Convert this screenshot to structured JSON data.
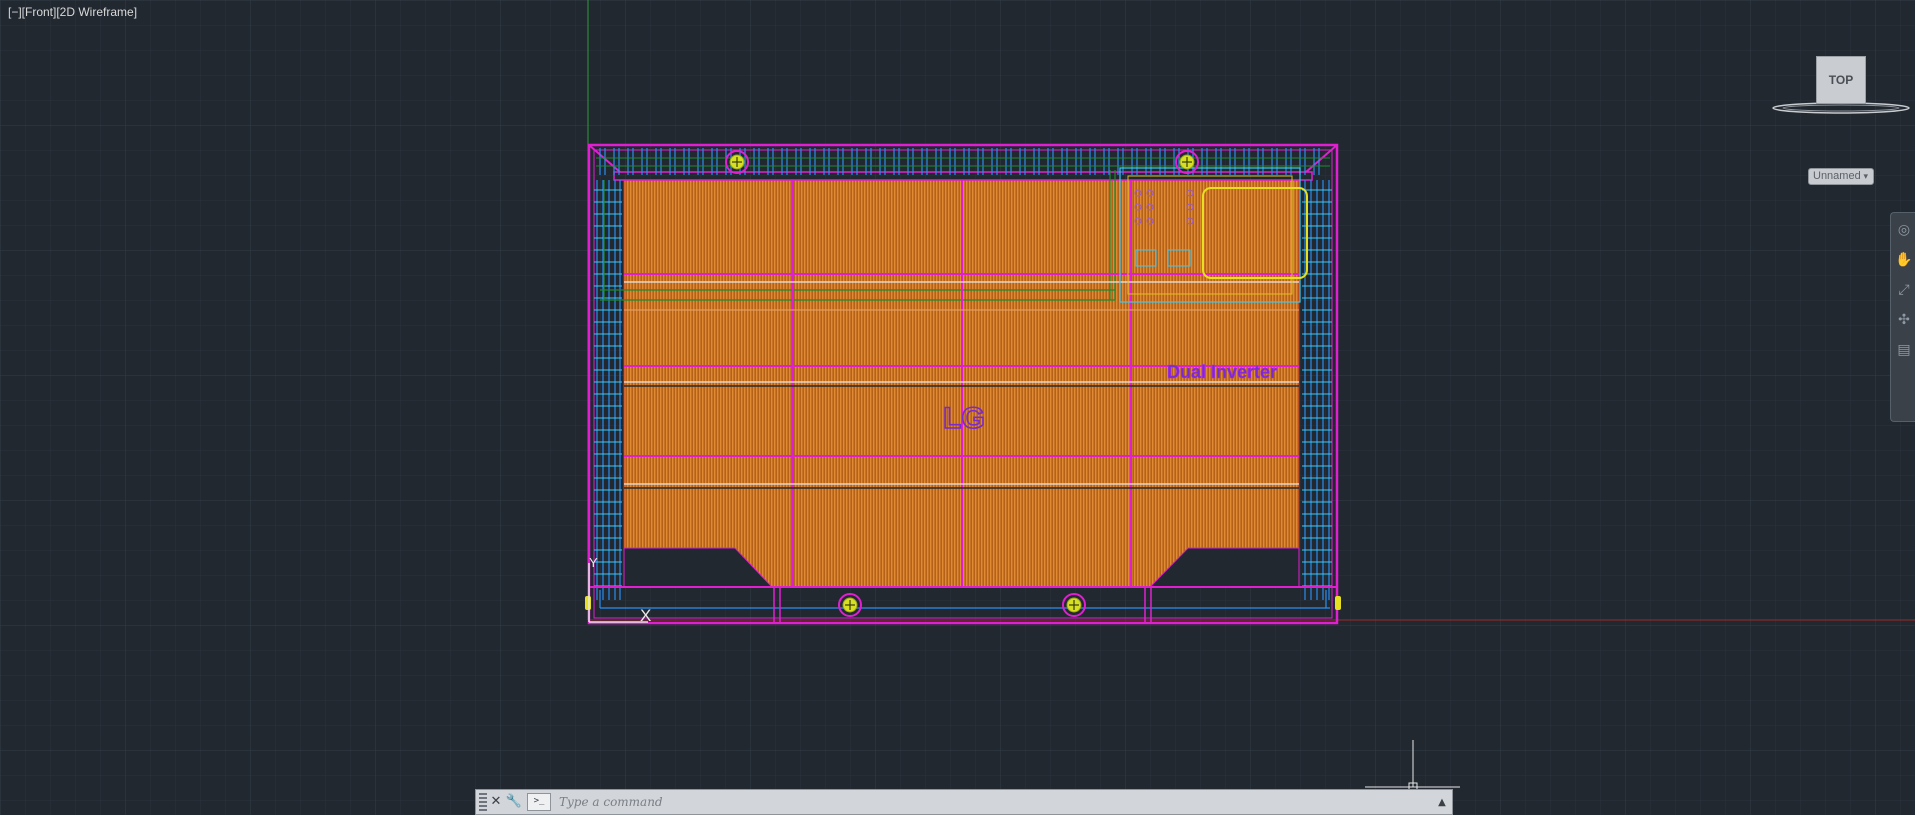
{
  "viewport": {
    "label": "[−][Front][2D Wireframe]",
    "colors": {
      "background": "#212830",
      "grid_minor": "#2a323b",
      "grid_major": "#343d47",
      "magenta": "#e020d0",
      "blue": "#2a8ef0",
      "cyan": "#3fc8f0",
      "orange": "#d67a22",
      "yellow": "#e6e020",
      "green": "#1e8a2e",
      "red_axis": "#9a2a2a",
      "green_axis": "#2e9a3a"
    }
  },
  "drawing": {
    "logo_text": "LG",
    "model_text": "Dual Inverter"
  },
  "ucs_icon": {
    "y_label": "Y",
    "x_label": "X"
  },
  "viewcube": {
    "face_label": "TOP"
  },
  "ucs_menu": {
    "label": "Unnamed"
  },
  "navbar": {
    "icons": [
      "wheel-icon",
      "pan-icon",
      "zoom-icon",
      "orbit-icon",
      "showmotion-icon"
    ]
  },
  "command_line": {
    "placeholder": "Type a command",
    "close_glyph": "✕",
    "customize_glyph": "🔧",
    "prompt_glyph": ">_",
    "history_glyph": "▲"
  }
}
